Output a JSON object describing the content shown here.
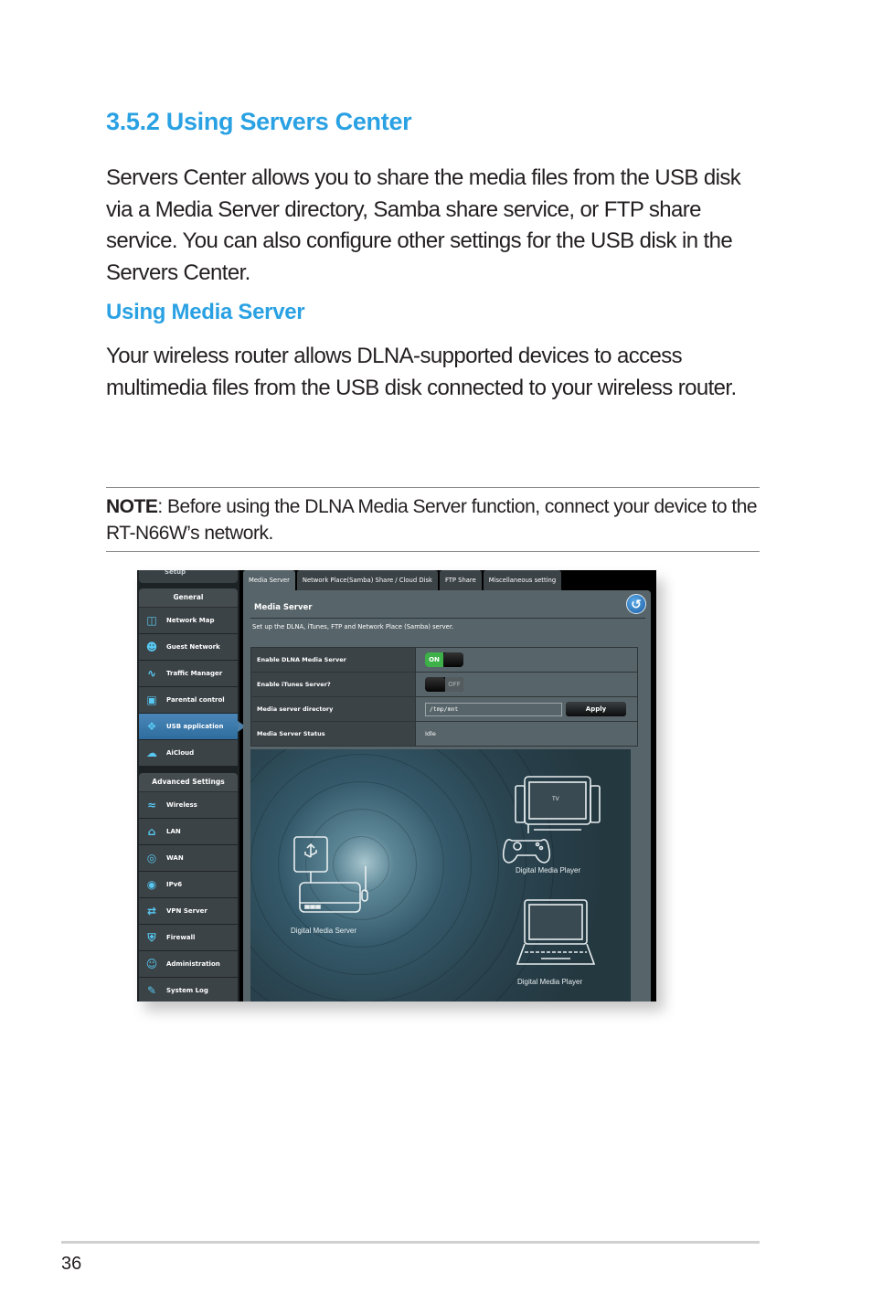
{
  "document": {
    "section_heading": "3.5.2 Using Servers Center",
    "intro_paragraph": "Servers Center allows you to share the media files from the USB disk via a Media Server directory, Samba share service, or FTP share service. You can also configure other settings for the USB disk in the Servers Center.",
    "subheading": "Using Media Server",
    "media_paragraph": "Your wireless router allows DLNA-supported devices to access multimedia files from the USB disk connected to your wireless router.",
    "note_label": "NOTE",
    "note_text": ":  Before using the DLNA Media Server function, connect your device to the RT-N66W’s network.",
    "page_number": "36"
  },
  "router_ui": {
    "sidebar": {
      "setup_label": "Setup",
      "general_header": "General",
      "general_items": [
        {
          "label": "Network Map",
          "icon": "network-map-icon",
          "active": false
        },
        {
          "label": "Guest Network",
          "icon": "guest-network-icon",
          "active": false
        },
        {
          "label": "Traffic Manager",
          "icon": "traffic-manager-icon",
          "active": false
        },
        {
          "label": "Parental control",
          "icon": "lock-icon",
          "active": false
        },
        {
          "label": "USB application",
          "icon": "puzzle-icon",
          "active": true
        },
        {
          "label": "AiCloud",
          "icon": "cloud-icon",
          "active": false
        }
      ],
      "advanced_header": "Advanced Settings",
      "advanced_items": [
        {
          "label": "Wireless",
          "icon": "wifi-icon"
        },
        {
          "label": "LAN",
          "icon": "house-icon"
        },
        {
          "label": "WAN",
          "icon": "globe-icon"
        },
        {
          "label": "IPv6",
          "icon": "ipv6-globe-icon"
        },
        {
          "label": "VPN Server",
          "icon": "vpn-icon"
        },
        {
          "label": "Firewall",
          "icon": "shield-icon"
        },
        {
          "label": "Administration",
          "icon": "admin-user-icon"
        },
        {
          "label": "System Log",
          "icon": "log-edit-icon"
        }
      ]
    },
    "tabs": [
      {
        "label": "Media Server",
        "active": true
      },
      {
        "label": "Network Place(Samba) Share / Cloud Disk",
        "active": false
      },
      {
        "label": "FTP Share",
        "active": false
      },
      {
        "label": "Miscellaneous setting",
        "active": false
      }
    ],
    "panel": {
      "title": "Media Server",
      "description": "Set up the DLNA, iTunes, FTP and Network Place (Samba) server.",
      "back_icon": "back-arrow-icon",
      "rows": {
        "dlna_label": "Enable DLNA Media Server",
        "dlna_state": "ON",
        "itunes_label": "Enable iTunes Server?",
        "itunes_state": "OFF",
        "directory_label": "Media server directory",
        "directory_value": "/tmp/mnt",
        "apply_label": "Apply",
        "status_label": "Media Server Status",
        "status_value": "Idle"
      },
      "illustration": {
        "server_label": "Digital  Media Server",
        "tv_label": "TV",
        "player1_label": "Digital  Media Player",
        "player2_label": "Digital  Media Player"
      }
    },
    "colors": {
      "toggle_on": "#3eb049",
      "active_nav": "#3f7cb0",
      "icon_accent": "#56c8f2"
    }
  }
}
